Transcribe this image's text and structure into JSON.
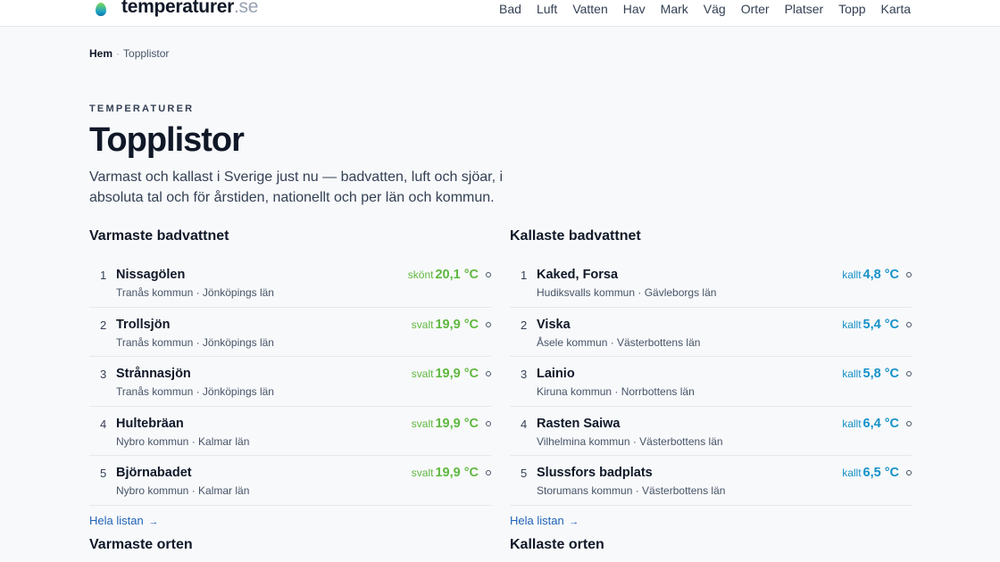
{
  "site": {
    "name": "temperaturer",
    "tld": ".se"
  },
  "nav": [
    "Bad",
    "Luft",
    "Vatten",
    "Hav",
    "Mark",
    "Väg",
    "Orter",
    "Platser",
    "Topp",
    "Karta"
  ],
  "breadcrumb": {
    "home": "Hem",
    "sep": "·",
    "current": "Topplistor"
  },
  "header": {
    "eyebrow": "TEMPERATURER",
    "title": "Topplistor",
    "lead": "Varmast och kallast i Sverige just nu — badvatten, luft och sjöar, i absoluta tal och för årstiden, nationellt och per län och kommun."
  },
  "warmest": {
    "title": "Varmaste badvattnet",
    "items": [
      {
        "rank": "1",
        "name": "Nissagölen",
        "sub": "Tranås kommun · Jönköpings län",
        "word": "skönt",
        "temp": "20,1 °C"
      },
      {
        "rank": "2",
        "name": "Trollsjön",
        "sub": "Tranås kommun · Jönköpings län",
        "word": "svalt",
        "temp": "19,9 °C"
      },
      {
        "rank": "3",
        "name": "Strånnasjön",
        "sub": "Tranås kommun · Jönköpings län",
        "word": "svalt",
        "temp": "19,9 °C"
      },
      {
        "rank": "4",
        "name": "Hultebräan",
        "sub": "Nybro kommun · Kalmar län",
        "word": "svalt",
        "temp": "19,9 °C"
      },
      {
        "rank": "5",
        "name": "Björnabadet",
        "sub": "Nybro kommun · Kalmar län",
        "word": "svalt",
        "temp": "19,9 °C"
      }
    ],
    "more": "Hela listan",
    "more_arrow": "→"
  },
  "coldest": {
    "title": "Kallaste badvattnet",
    "items": [
      {
        "rank": "1",
        "name": "Kaked, Forsa",
        "sub": "Hudiksvalls kommun · Gävleborgs län",
        "word": "kallt",
        "temp": "4,8 °C"
      },
      {
        "rank": "2",
        "name": "Viska",
        "sub": "Åsele kommun · Västerbottens län",
        "word": "kallt",
        "temp": "5,4 °C"
      },
      {
        "rank": "3",
        "name": "Lainio",
        "sub": "Kiruna kommun · Norrbottens län",
        "word": "kallt",
        "temp": "5,8 °C"
      },
      {
        "rank": "4",
        "name": "Rasten Saiwa",
        "sub": "Vilhelmina kommun · Västerbottens län",
        "word": "kallt",
        "temp": "6,4 °C"
      },
      {
        "rank": "5",
        "name": "Slussfors badplats",
        "sub": "Storumans kommun · Västerbottens län",
        "word": "kallt",
        "temp": "6,5 °C"
      }
    ],
    "more": "Hela listan",
    "more_arrow": "→"
  },
  "next_sections": {
    "warm": "Varmaste orten",
    "cold": "Kallaste orten"
  },
  "colors": {
    "warm": "#5fb83f",
    "cold": "#1691c7",
    "link": "#1f63b8"
  }
}
